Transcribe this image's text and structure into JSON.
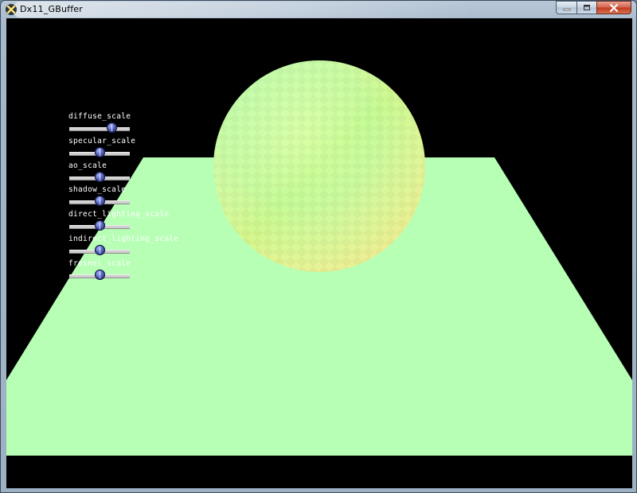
{
  "window": {
    "title": "Dx11_GBuffer",
    "icon": "directx-app-icon",
    "caption_buttons": [
      "minimize-icon",
      "maximize-icon",
      "close-icon"
    ]
  },
  "colors": {
    "background": "#000000",
    "floor_plane": "#b6ffb5",
    "sphere_light": "#bfffa8",
    "sphere_warm": "#eef58f",
    "label_text": "#ffffff",
    "slider_thumb": "#4d5bb5"
  },
  "sliders": [
    {
      "label": "diffuse_scale",
      "value": 0.7
    },
    {
      "label": "specular_scale",
      "value": 0.5
    },
    {
      "label": "ao_scale",
      "value": 0.5
    },
    {
      "label": "shadow_scale",
      "value": 0.5
    },
    {
      "label": "direct_lighting_scale",
      "value": 0.5
    },
    {
      "label": "indirect_lighting_scale",
      "value": 0.5
    },
    {
      "label": "fresnel_scale",
      "value": 0.5
    }
  ]
}
